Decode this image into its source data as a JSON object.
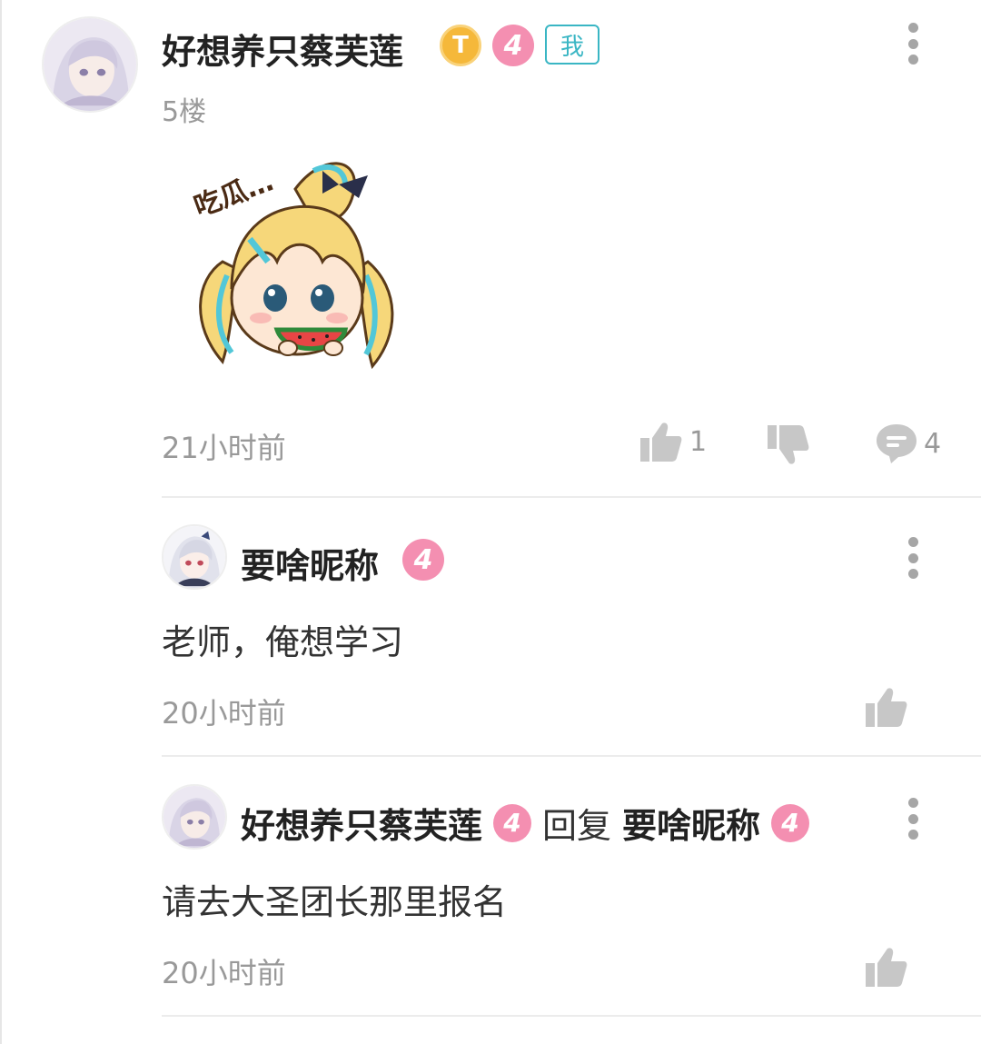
{
  "main_post": {
    "username": "好想养只蔡芙莲",
    "badge_t": "T",
    "level": "4",
    "me_badge": "我",
    "floor": "5楼",
    "sticker_text": "吃瓜…",
    "time": "21小时前",
    "likes": "1",
    "comments": "4"
  },
  "replies": [
    {
      "username": "要啥昵称",
      "level": "4",
      "text": "老师，俺想学习",
      "time": "20小时前"
    },
    {
      "username": "好想养只蔡芙莲",
      "level": "4",
      "reply_word": "回复",
      "reply_to": "要啥昵称",
      "reply_to_level": "4",
      "text": "请去大圣团长那里报名",
      "time": "20小时前"
    }
  ],
  "colors": {
    "level_badge": "#f48fb1",
    "accent_teal": "#3ab6c4",
    "muted_text": "#999999",
    "gold_badge": "#f5b83a"
  }
}
